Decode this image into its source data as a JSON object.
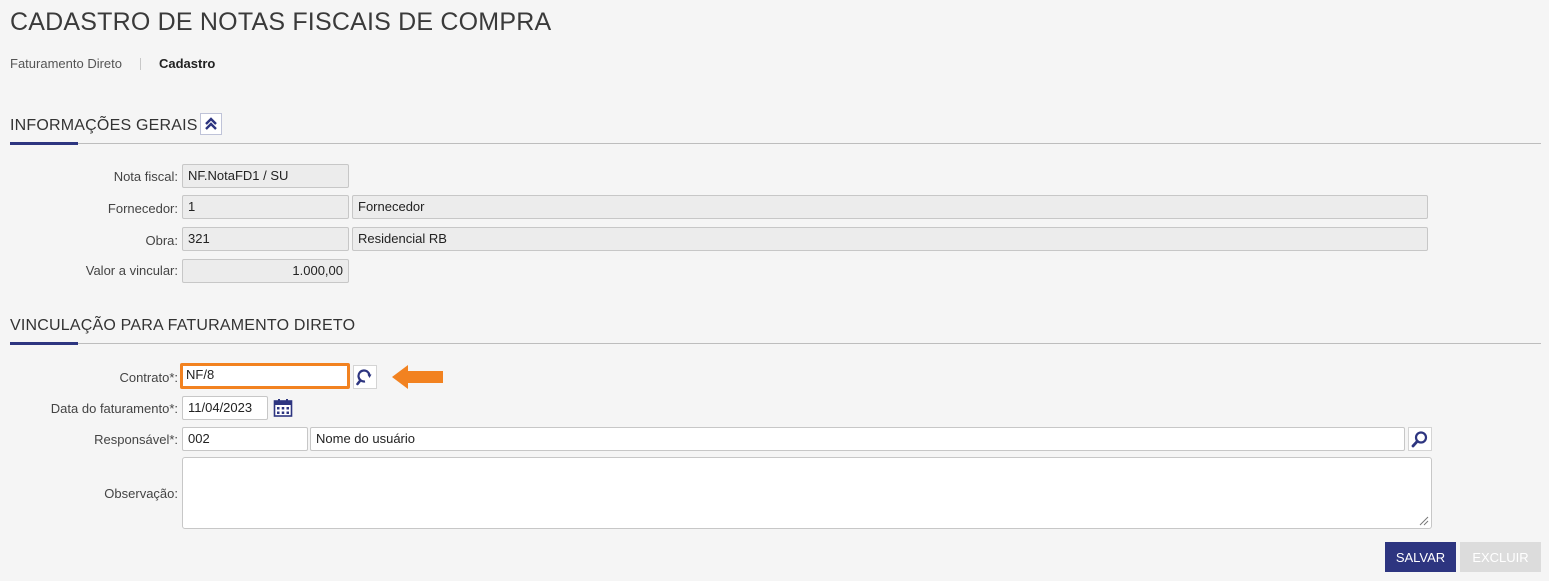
{
  "page": {
    "title": "CADASTRO DE NOTAS FISCAIS DE COMPRA"
  },
  "breadcrumb": {
    "link": "Faturamento Direto",
    "current": "Cadastro"
  },
  "section_general": {
    "title": "INFORMAÇÕES GERAIS",
    "collapse_icon": "double-chevron-up-icon",
    "fields": {
      "nota_fiscal": {
        "label": "Nota fiscal:",
        "value": "NF.NotaFD1 / SU"
      },
      "fornecedor": {
        "label": "Fornecedor:",
        "code": "1",
        "name": "Fornecedor"
      },
      "obra": {
        "label": "Obra:",
        "code": "321",
        "name": "Residencial RB"
      },
      "valor": {
        "label": "Valor a vincular:",
        "value": "1.000,00"
      }
    }
  },
  "section_link": {
    "title": "VINCULAÇÃO PARA FATURAMENTO DIRETO",
    "fields": {
      "contrato": {
        "label": "Contrato*:",
        "value": "NF/8",
        "search_icon": "search-refresh-icon"
      },
      "data": {
        "label": "Data do faturamento*:",
        "value": "11/04/2023",
        "icon": "calendar-icon"
      },
      "responsavel": {
        "label": "Responsável*:",
        "code": "002",
        "name": "Nome do usuário",
        "search_icon": "search-icon"
      },
      "observacao": {
        "label": "Observação:",
        "value": ""
      }
    }
  },
  "actions": {
    "save": "SALVAR",
    "delete": "EXCLUIR"
  },
  "colors": {
    "primary": "#2d3580",
    "highlight": "#f28220",
    "disabled": "#dcdcdc"
  }
}
